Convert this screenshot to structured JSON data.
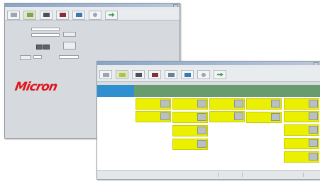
{
  "back_window": {
    "title": "",
    "logo_text": "Micron",
    "toolbar_icons": [
      "new-icon",
      "open-icon",
      "calendar-icon",
      "chart-icon",
      "device-icon",
      "help-icon",
      "arrow-icon"
    ],
    "form": {
      "labels": [
        "",
        "",
        "",
        ""
      ],
      "buttons": [
        "",
        "",
        ""
      ]
    }
  },
  "front_window": {
    "title": "",
    "menu": [
      "",
      "",
      "",
      ""
    ],
    "toolbar_icons": [
      "new-icon",
      "schedule-icon",
      "calendar-icon",
      "chart-icon",
      "info-icon",
      "device-icon",
      "help-icon",
      "arrow-icon"
    ],
    "columns": [
      {
        "color": "#2f8fcf",
        "header": ""
      },
      {
        "color": "#689c6e",
        "header": ""
      },
      {
        "color": "#689c6e",
        "header": ""
      },
      {
        "color": "#689c6e",
        "header": ""
      },
      {
        "color": "#689c6e",
        "header": ""
      },
      {
        "color": "#689c6e",
        "header": ""
      }
    ],
    "card_color": "#eaf000",
    "statusbar": [
      "",
      "",
      "",
      ""
    ]
  }
}
